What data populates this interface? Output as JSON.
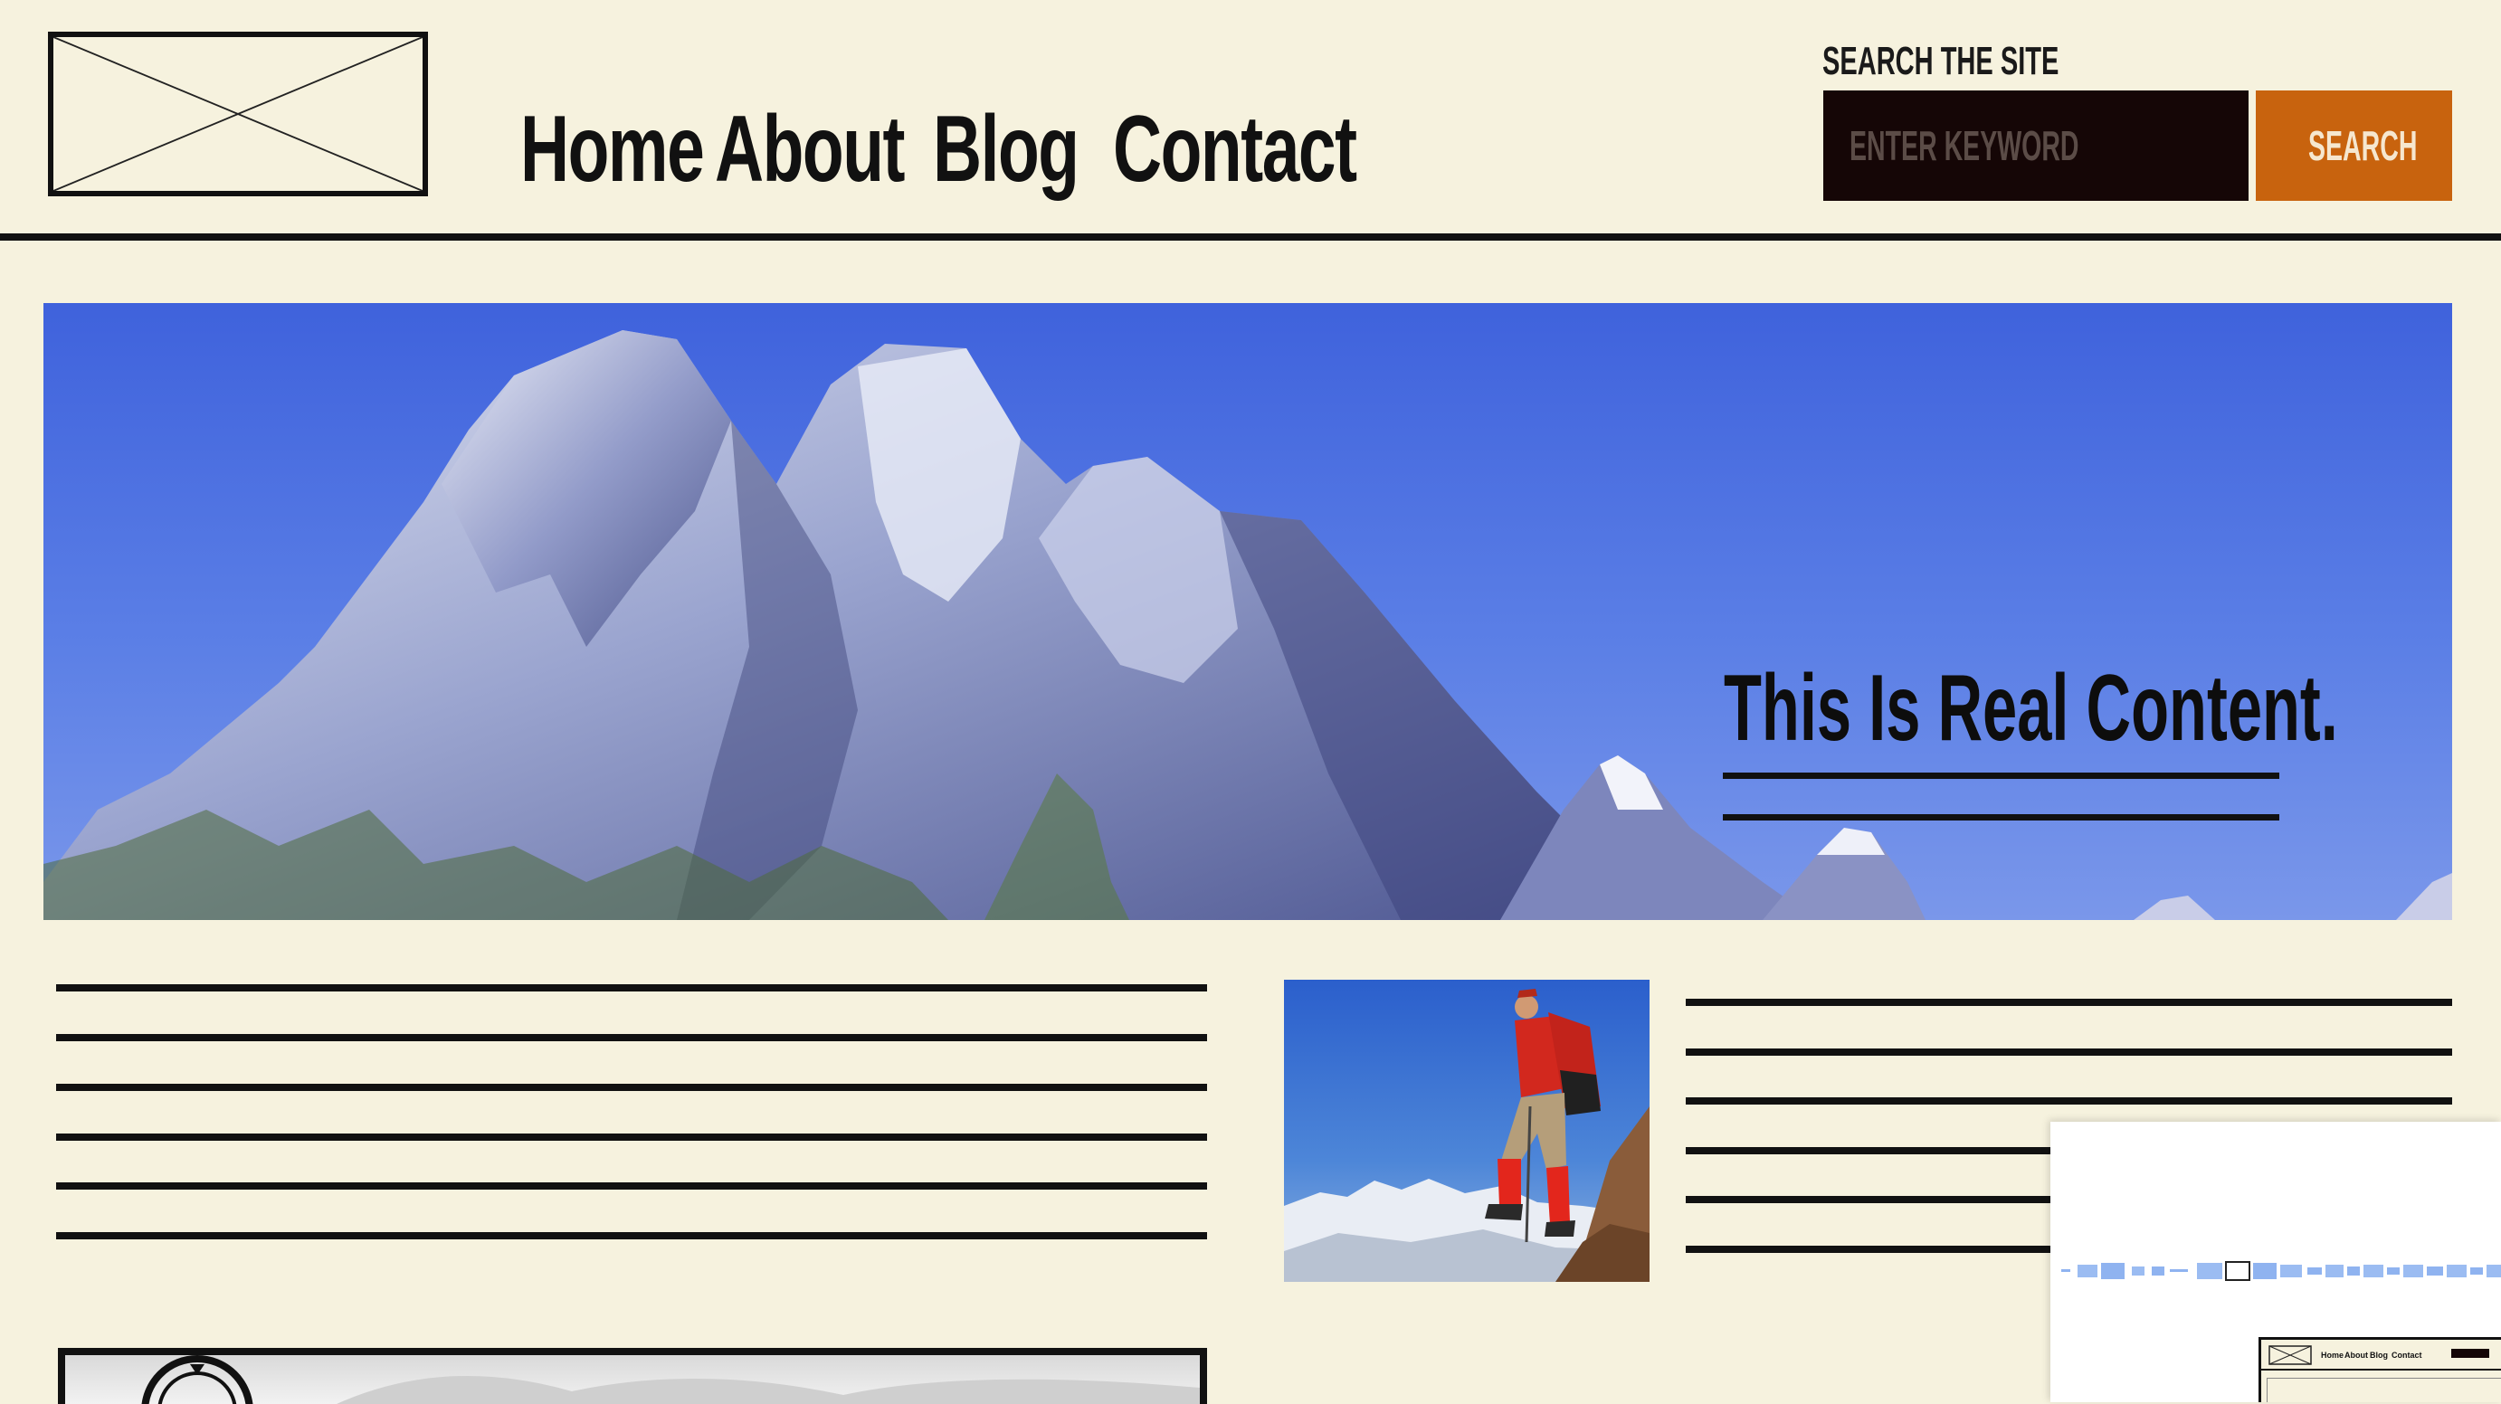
{
  "header": {
    "logo": "logo-placeholder",
    "nav": [
      {
        "label": "Home"
      },
      {
        "label": "About"
      },
      {
        "label": "Blog"
      },
      {
        "label": "Contact"
      }
    ],
    "search": {
      "label": "SEARCH THE SITE",
      "placeholder": "ENTER KEYWORD",
      "button_label": "SEARCH"
    }
  },
  "hero": {
    "title": "This Is Real Content."
  },
  "minimap": {
    "nav": [
      "Home",
      "About",
      "Blog",
      "Contact"
    ]
  },
  "colors": {
    "background": "#f6f2de",
    "ink": "#111111",
    "search_input_bg": "#150606",
    "accent": "#c8630e"
  }
}
